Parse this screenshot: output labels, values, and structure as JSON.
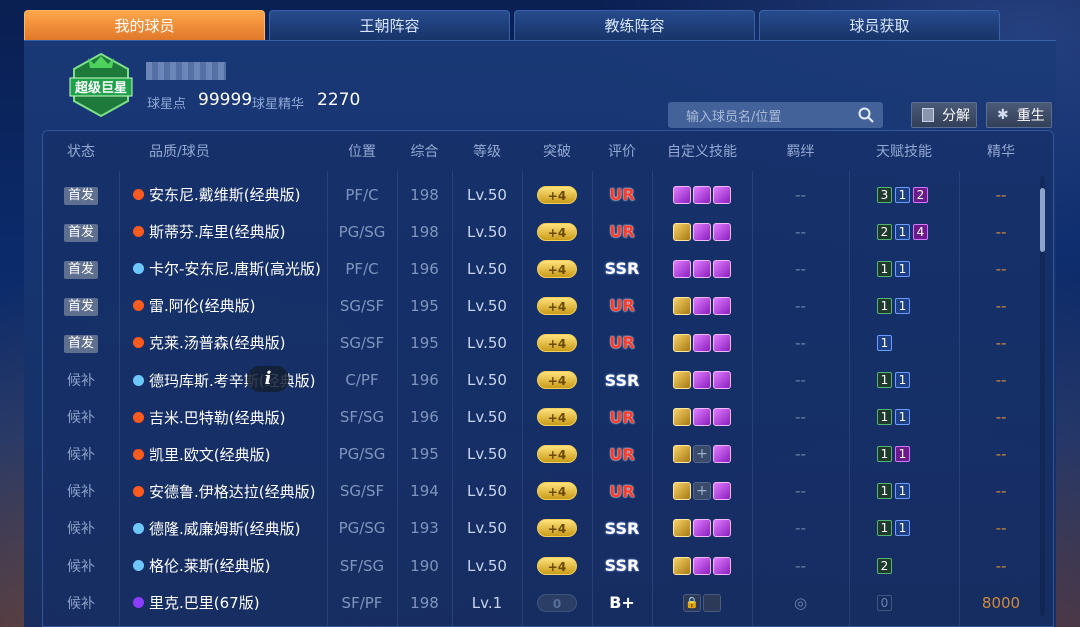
{
  "tabs": [
    {
      "label": "我的球员",
      "active": true
    },
    {
      "label": "王朝阵容",
      "active": false
    },
    {
      "label": "教练阵容",
      "active": false
    },
    {
      "label": "球员获取",
      "active": false
    }
  ],
  "header": {
    "badge_text": "超级巨星",
    "stats": [
      {
        "label": "球星点",
        "value": "99999"
      },
      {
        "label": "球星精华",
        "value": "2270"
      }
    ]
  },
  "search": {
    "placeholder": "输入球员名/位置"
  },
  "actions": {
    "decompose": "分解",
    "rebirth": "重生"
  },
  "table": {
    "columns": [
      "状态",
      "品质/球员",
      "位置",
      "综合",
      "等级",
      "突破",
      "评价",
      "自定义技能",
      "羁绊",
      "天赋技能",
      "精华"
    ],
    "rows": [
      {
        "status": "首发",
        "starter": true,
        "dot": "#ff5a1f",
        "name": "安东尼.戴维斯(经典版)",
        "position": "PF/C",
        "score": "198",
        "level": "Lv.50",
        "breakthrough": "+4",
        "grade": "UR",
        "skills": [
          "purple",
          "purple",
          "purple"
        ],
        "bond": "--",
        "talents": [
          {
            "n": "3",
            "c": "g"
          },
          {
            "n": "1",
            "c": "b"
          },
          {
            "n": "2",
            "c": "p"
          }
        ],
        "essence": "--"
      },
      {
        "status": "首发",
        "starter": true,
        "dot": "#ff5a1f",
        "name": "斯蒂芬.库里(经典版)",
        "position": "PG/SG",
        "score": "198",
        "level": "Lv.50",
        "breakthrough": "+4",
        "grade": "UR",
        "skills": [
          "gold",
          "purple",
          "purple"
        ],
        "bond": "--",
        "talents": [
          {
            "n": "2",
            "c": "g"
          },
          {
            "n": "1",
            "c": "b"
          },
          {
            "n": "4",
            "c": "p"
          }
        ],
        "essence": "--"
      },
      {
        "status": "首发",
        "starter": true,
        "dot": "#6ec7ff",
        "name": "卡尔-安东尼.唐斯(高光版)",
        "position": "PF/C",
        "score": "196",
        "level": "Lv.50",
        "breakthrough": "+4",
        "grade": "SSR",
        "skills": [
          "purple",
          "purple",
          "purple"
        ],
        "bond": "--",
        "talents": [
          {
            "n": "1",
            "c": "g"
          },
          {
            "n": "1",
            "c": "b"
          }
        ],
        "essence": "--"
      },
      {
        "status": "首发",
        "starter": true,
        "dot": "#ff5a1f",
        "name": "雷.阿伦(经典版)",
        "position": "SG/SF",
        "score": "195",
        "level": "Lv.50",
        "breakthrough": "+4",
        "grade": "UR",
        "skills": [
          "gold",
          "purple",
          "purple"
        ],
        "bond": "--",
        "talents": [
          {
            "n": "1",
            "c": "g"
          },
          {
            "n": "1",
            "c": "b"
          }
        ],
        "essence": "--"
      },
      {
        "status": "首发",
        "starter": true,
        "dot": "#ff5a1f",
        "name": "克莱.汤普森(经典版)",
        "position": "SG/SF",
        "score": "195",
        "level": "Lv.50",
        "breakthrough": "+4",
        "grade": "UR",
        "skills": [
          "gold",
          "purple",
          "purple"
        ],
        "bond": "--",
        "talents": [
          {
            "n": "1",
            "c": "b"
          }
        ],
        "essence": "--"
      },
      {
        "status": "候补",
        "starter": false,
        "dot": "#6ec7ff",
        "name": "德玛库斯.考辛斯(经典版)",
        "position": "C/PF",
        "score": "196",
        "level": "Lv.50",
        "breakthrough": "+4",
        "grade": "SSR",
        "skills": [
          "gold",
          "purple",
          "purple"
        ],
        "bond": "--",
        "talents": [
          {
            "n": "1",
            "c": "g"
          },
          {
            "n": "1",
            "c": "b"
          }
        ],
        "essence": "--"
      },
      {
        "status": "候补",
        "starter": false,
        "dot": "#ff5a1f",
        "name": "吉米.巴特勒(经典版)",
        "position": "SF/SG",
        "score": "196",
        "level": "Lv.50",
        "breakthrough": "+4",
        "grade": "UR",
        "skills": [
          "gold",
          "purple",
          "purple"
        ],
        "bond": "--",
        "talents": [
          {
            "n": "1",
            "c": "g"
          },
          {
            "n": "1",
            "c": "b"
          }
        ],
        "essence": "--"
      },
      {
        "status": "候补",
        "starter": false,
        "dot": "#ff5a1f",
        "name": "凯里.欧文(经典版)",
        "position": "PG/SG",
        "score": "195",
        "level": "Lv.50",
        "breakthrough": "+4",
        "grade": "UR",
        "skills": [
          "gold",
          "plus",
          "purple"
        ],
        "bond": "--",
        "talents": [
          {
            "n": "1",
            "c": "g"
          },
          {
            "n": "1",
            "c": "p"
          }
        ],
        "essence": "--"
      },
      {
        "status": "候补",
        "starter": false,
        "dot": "#ff5a1f",
        "name": "安德鲁.伊格达拉(经典版)",
        "position": "SG/SF",
        "score": "194",
        "level": "Lv.50",
        "breakthrough": "+4",
        "grade": "UR",
        "skills": [
          "gold",
          "plus",
          "purple"
        ],
        "bond": "--",
        "talents": [
          {
            "n": "1",
            "c": "g"
          },
          {
            "n": "1",
            "c": "b"
          }
        ],
        "essence": "--"
      },
      {
        "status": "候补",
        "starter": false,
        "dot": "#6ec7ff",
        "name": "德隆.威廉姆斯(经典版)",
        "position": "PG/SG",
        "score": "193",
        "level": "Lv.50",
        "breakthrough": "+4",
        "grade": "SSR",
        "skills": [
          "gold",
          "purple",
          "purple"
        ],
        "bond": "--",
        "talents": [
          {
            "n": "1",
            "c": "g"
          },
          {
            "n": "1",
            "c": "b"
          }
        ],
        "essence": "--"
      },
      {
        "status": "候补",
        "starter": false,
        "dot": "#6ec7ff",
        "name": "格伦.莱斯(经典版)",
        "position": "SF/SG",
        "score": "190",
        "level": "Lv.50",
        "breakthrough": "+4",
        "grade": "SSR",
        "skills": [
          "gold",
          "purple",
          "purple"
        ],
        "bond": "--",
        "talents": [
          {
            "n": "2",
            "c": "g"
          }
        ],
        "essence": "--"
      },
      {
        "status": "候补",
        "starter": false,
        "dot": "#8a3cff",
        "name": "里克.巴里(67版)",
        "position": "SF/PF",
        "score": "198",
        "level": "Lv.1",
        "breakthrough": "0",
        "grade": "B+",
        "skills": [
          "lock",
          "lock"
        ],
        "bond": "",
        "talents": [
          {
            "n": "0",
            "c": "n"
          }
        ],
        "essence": "8000"
      }
    ]
  }
}
